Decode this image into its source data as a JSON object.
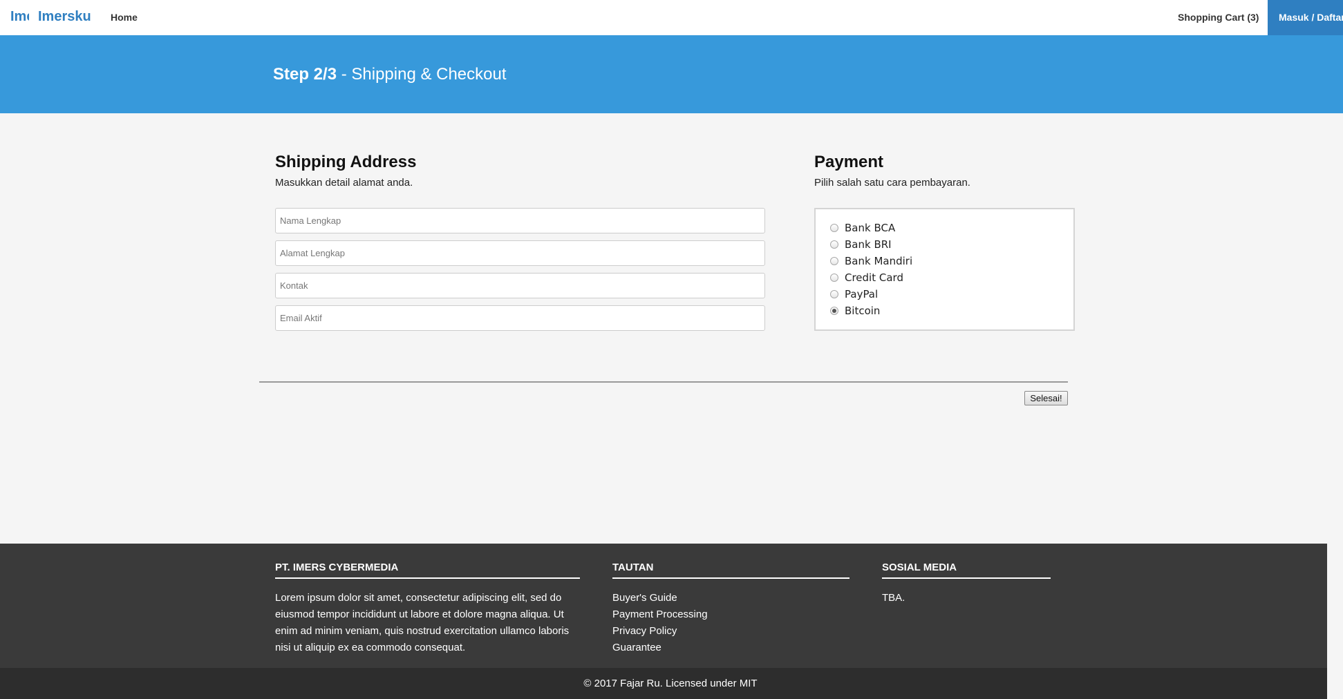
{
  "nav": {
    "logo_text": "Imersku",
    "brand": "Imersku",
    "home": "Home",
    "cart": "Shopping Cart (3)",
    "login": "Masuk / Daftar"
  },
  "hero": {
    "step": "Step 2/3",
    "title": " - Shipping & Checkout"
  },
  "shipping": {
    "title": "Shipping Address",
    "subtitle": "Masukkan detail alamat anda.",
    "fields": [
      {
        "placeholder": "Nama Lengkap",
        "value": ""
      },
      {
        "placeholder": "Alamat Lengkap",
        "value": ""
      },
      {
        "placeholder": "Kontak",
        "value": ""
      },
      {
        "placeholder": "Email Aktif",
        "value": ""
      }
    ]
  },
  "payment": {
    "title": "Payment",
    "subtitle": "Pilih salah satu cara pembayaran.",
    "options": [
      {
        "label": "Bank BCA",
        "checked": false
      },
      {
        "label": "Bank BRI",
        "checked": false
      },
      {
        "label": "Bank Mandiri",
        "checked": false
      },
      {
        "label": "Credit Card",
        "checked": false
      },
      {
        "label": "PayPal",
        "checked": false
      },
      {
        "label": "Bitcoin",
        "checked": true
      }
    ]
  },
  "submit_label": "Selesai!",
  "footer": {
    "company_title": "PT. IMERS CYBERMEDIA",
    "company_text": "Lorem ipsum dolor sit amet, consectetur adipiscing elit, sed do eiusmod tempor incididunt ut labore et dolore magna aliqua. Ut enim ad minim veniam, quis nostrud exercitation ullamco laboris nisi ut aliquip ex ea commodo consequat.",
    "links_title": "TAUTAN",
    "links": [
      "Buyer's Guide",
      "Payment Processing",
      "Privacy Policy",
      "Guarantee"
    ],
    "social_title": "SOSIAL MEDIA",
    "social_text": "TBA.",
    "copyright": "© 2017 Fajar Ru. Licensed under MIT"
  },
  "colors": {
    "brand": "#2f7fc1",
    "hero_bg": "#3799db",
    "footer_bg": "#3a3a3a",
    "copyright_bg": "#2d2d2d"
  }
}
